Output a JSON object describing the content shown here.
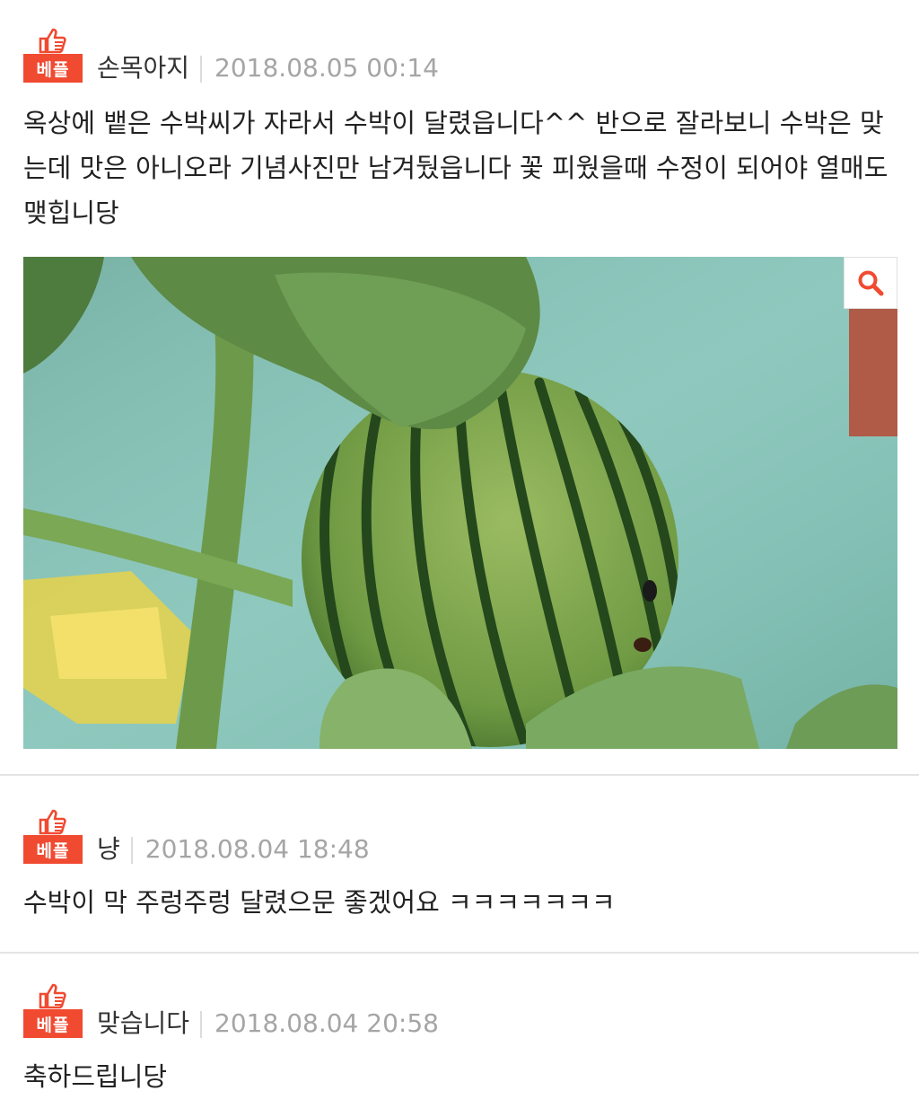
{
  "comments": [
    {
      "badge_label": "베플",
      "badge_icon": "thumbs-up-icon",
      "nickname": "손목아지",
      "date": "2018.08.05 00:14",
      "text": "옥상에 뱉은 수박씨가 자라서 수박이 달렸읍니다^^ 반으로 잘라보니 수박은 맞는데 맛은 아니오라 기념사진만 남겨뒀읍니다 꽃 피웠을때 수정이 되어야 열매도 맺힙니당",
      "has_photo": true,
      "photo_action_icon": "magnifier-icon"
    },
    {
      "badge_label": "베플",
      "badge_icon": "thumbs-up-icon",
      "nickname": "냥",
      "date": "2018.08.04 18:48",
      "text": "수박이 막 주렁주렁 달렸으문 좋겠어요 ㅋㅋㅋㅋㅋㅋㅋ"
    },
    {
      "badge_label": "베플",
      "badge_icon": "thumbs-up-icon",
      "nickname": "맞습니다",
      "date": "2018.08.04 20:58",
      "text": "축하드립니당"
    }
  ],
  "colors": {
    "badge": "#f04a31",
    "date": "#a5a5a5",
    "divider": "#e4e4e4"
  }
}
